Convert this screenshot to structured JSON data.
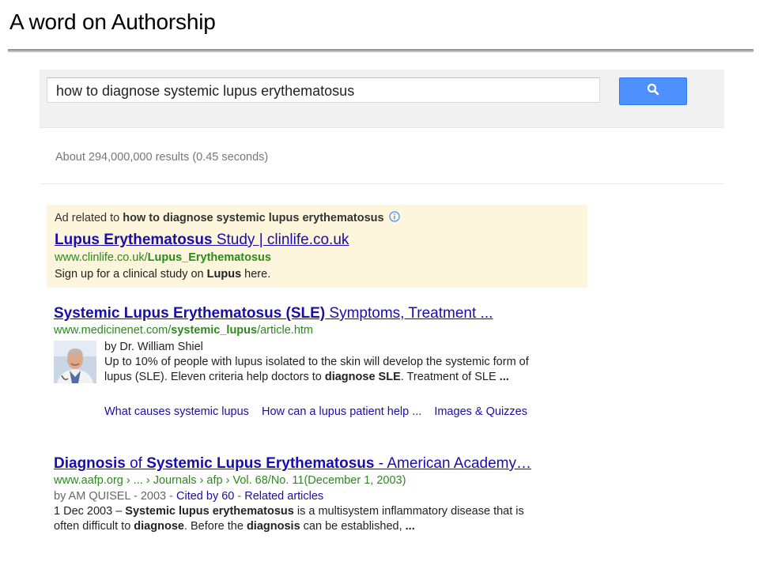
{
  "slide": {
    "title": "A word on Authorship"
  },
  "search": {
    "query": "how to diagnose systemic lupus erythematosus",
    "button_icon": "search-icon",
    "accent": "#4d90fe"
  },
  "stats": {
    "text": "About 294,000,000 results (0.45 seconds)"
  },
  "ad": {
    "label_prefix": "Ad related to",
    "label_query": "how to diagnose systemic lupus erythematosus",
    "info_icon": "info-icon",
    "title_bold": "Lupus Erythematosus",
    "title_rest": " Study | clinlife.co.uk",
    "url_plain": "www.clinlife.co.uk/",
    "url_bold": "Lupus_Erythematosus",
    "desc_pre": "Sign up for a clinical study on ",
    "desc_bold": "Lupus",
    "desc_post": " here."
  },
  "results": [
    {
      "title_bold": "Systemic Lupus Erythematosus (SLE)",
      "title_rest": " Symptoms, Treatment ...",
      "url_plain1": "www.medicinenet.com/",
      "url_bold": "systemic_lupus",
      "url_plain2": "/article.htm",
      "author": "by Dr. William Shiel",
      "snippet_1": "Up to 10% of people with lupus isolated to the skin will develop the systemic form of lupus (SLE). Eleven criteria help doctors to ",
      "snippet_bold": "diagnose SLE",
      "snippet_2": ". Treatment of SLE ",
      "snippet_end": "...",
      "sitelinks": [
        "What causes systemic lupus",
        "How can a lupus patient help ...",
        "Images & Quizzes"
      ]
    },
    {
      "title_bold1": "Diagnosis",
      "title_mid": " of ",
      "title_bold2": "Systemic Lupus Erythematosus",
      "title_rest": " - American Academy…",
      "breadcrumb": "www.aafp.org › ... › Journals › afp › Vol. 68/No. 11(December 1, 2003)",
      "meta_prefix": "by AM QUISEL - 2003 - ",
      "cited": "Cited by 60",
      "meta_sep": " - ",
      "related": "Related articles",
      "snip_date": "1 Dec 2003 – ",
      "snip_bold1": "Systemic lupus erythematosus",
      "snip_text1": " is a multisystem inflammatory disease that is often difficult to ",
      "snip_bold2": "diagnose",
      "snip_text2": ". Before the ",
      "snip_bold3": "diagnosis",
      "snip_text3": " can be established, ",
      "snip_end": "..."
    }
  ]
}
